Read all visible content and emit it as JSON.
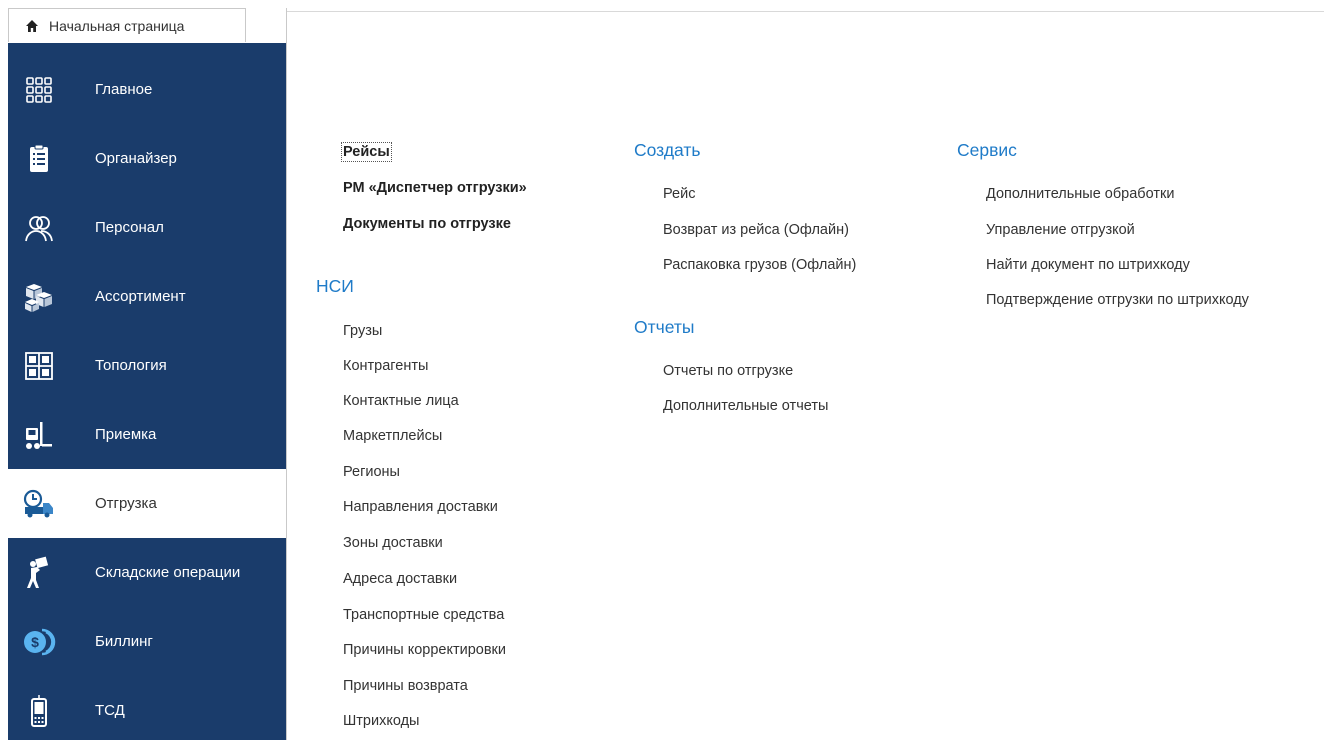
{
  "home_tab": {
    "label": "Начальная страница",
    "icon": "home-icon"
  },
  "sidebar": {
    "items": [
      {
        "label": "Главное",
        "icon": "grid-icon",
        "active": false
      },
      {
        "label": "Органайзер",
        "icon": "clipboard-icon",
        "active": false
      },
      {
        "label": "Персонал",
        "icon": "people-icon",
        "active": false
      },
      {
        "label": "Ассортимент",
        "icon": "boxes-icon",
        "active": false
      },
      {
        "label": "Топология",
        "icon": "shelves-icon",
        "active": false
      },
      {
        "label": "Приемка",
        "icon": "forklift-icon",
        "active": false
      },
      {
        "label": "Отгрузка",
        "icon": "truck-clock-icon",
        "active": true
      },
      {
        "label": "Складские операции",
        "icon": "worker-box-icon",
        "active": false
      },
      {
        "label": "Биллинг",
        "icon": "coins-icon",
        "active": false
      },
      {
        "label": "ТСД",
        "icon": "scanner-icon",
        "active": false
      }
    ],
    "colors": {
      "background": "#1a3c6b",
      "active_background": "#ffffff"
    }
  },
  "main": {
    "top_links": [
      "Рейсы",
      "РМ «Диспетчер отгрузки»",
      "Документы по отгрузке"
    ],
    "nsi": {
      "title": "НСИ",
      "items": [
        "Грузы",
        "Контрагенты",
        "Контактные лица",
        "Маркетплейсы",
        "Регионы",
        "Направления доставки",
        "Зоны доставки",
        "Адреса доставки",
        "Транспортные средства",
        "Причины корректировки",
        "Причины возврата",
        "Штрихкоды"
      ]
    },
    "create": {
      "title": "Создать",
      "items": [
        "Рейс",
        "Возврат из рейса (Офлайн)",
        "Распаковка грузов (Офлайн)"
      ]
    },
    "reports": {
      "title": "Отчеты",
      "items": [
        "Отчеты по отгрузке",
        "Дополнительные отчеты"
      ]
    },
    "service": {
      "title": "Сервис",
      "items": [
        "Дополнительные обработки",
        "Управление отгрузкой",
        "Найти документ по штрихкоду",
        "Подтверждение отгрузки по штрихкоду"
      ]
    },
    "colors": {
      "section_title": "#1f7bc8"
    }
  }
}
